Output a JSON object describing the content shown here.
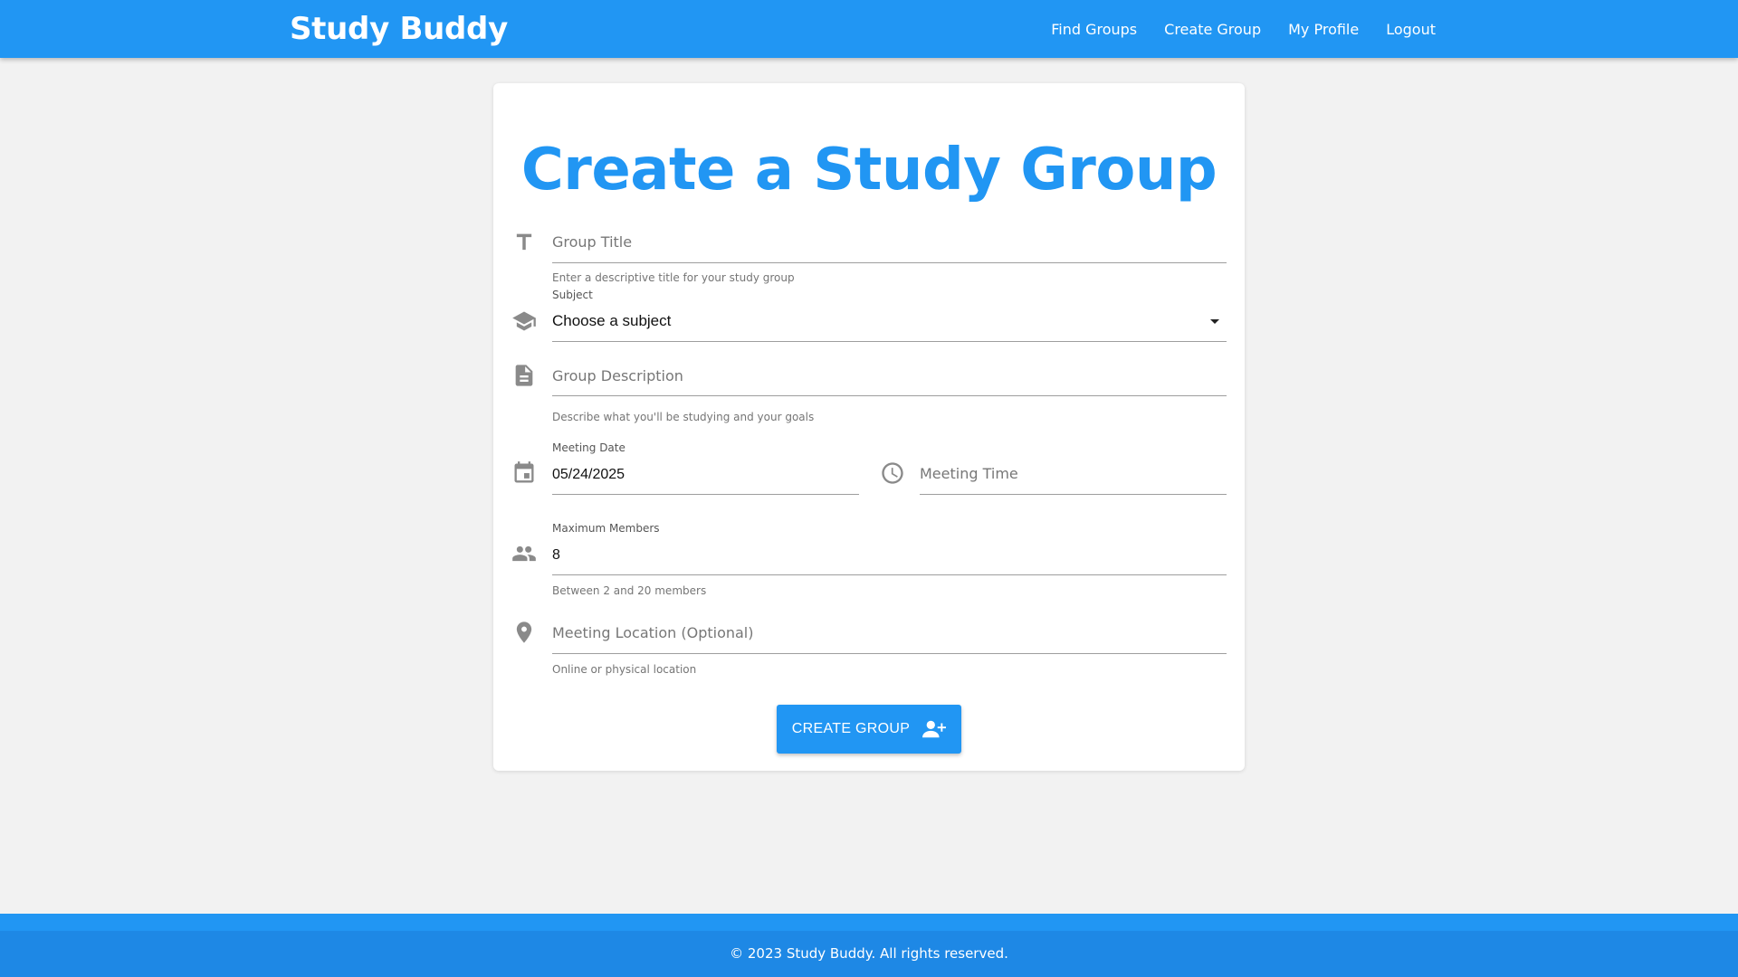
{
  "navbar": {
    "brand": "Study Buddy",
    "links": [
      {
        "label": "Find Groups"
      },
      {
        "label": "Create Group"
      },
      {
        "label": "My Profile"
      },
      {
        "label": "Logout"
      }
    ]
  },
  "form": {
    "title": "Create a Study Group",
    "group_title": {
      "placeholder": "Group Title",
      "helper": "Enter a descriptive title for your study group",
      "icon": "text-format-icon"
    },
    "subject": {
      "label": "Subject",
      "value": "Choose a subject",
      "icon": "school-icon"
    },
    "description": {
      "placeholder": "Group Description",
      "helper": "Describe what you'll be studying and your goals",
      "icon": "document-icon"
    },
    "meeting_date": {
      "label": "Meeting Date",
      "value": "05/24/2025",
      "icon": "calendar-icon"
    },
    "meeting_time": {
      "placeholder": "Meeting Time",
      "icon": "clock-icon"
    },
    "max_members": {
      "label": "Maximum Members",
      "value": "8",
      "helper": "Between 2 and 20 members",
      "icon": "people-icon"
    },
    "location": {
      "placeholder": "Meeting Location (Optional)",
      "helper": "Online or physical location",
      "icon": "location-pin-icon"
    },
    "submit": {
      "label": "CREATE GROUP",
      "icon": "person-add-icon"
    }
  },
  "footer": {
    "text": "© 2023 Study Buddy. All rights reserved."
  },
  "colors": {
    "primary": "#2196f3",
    "background": "#f2f2f2",
    "card": "#ffffff",
    "icon": "#8a8a8a"
  }
}
